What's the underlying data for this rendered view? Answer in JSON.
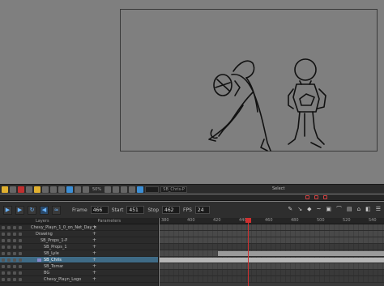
{
  "toolbar": {
    "zoom": "50%",
    "layer_name": "SB_Chris-P",
    "mode_label": "Select"
  },
  "playback": {
    "frame_label": "Frame",
    "frame_value": "466",
    "start_label": "Start",
    "start_value": "451",
    "stop_label": "Stop",
    "stop_value": "462",
    "fps_label": "FPS",
    "fps_value": "24"
  },
  "layers_panel": {
    "header_layers": "Layers",
    "header_parameters": "Parameters",
    "rows": [
      {
        "name": "Chevy_Playn_1_0_on_Net_Day_e",
        "selected": false
      },
      {
        "name": "Drawing",
        "selected": false
      },
      {
        "name": "SB_Props_1-P",
        "selected": false
      },
      {
        "name": "SB_Props_1",
        "selected": false
      },
      {
        "name": "SB_Lyle",
        "selected": false
      },
      {
        "name": "SB_Chris",
        "selected": true
      },
      {
        "name": "SB_Tomar",
        "selected": false
      },
      {
        "name": "BG",
        "selected": false
      },
      {
        "name": "Chevy_Playn_Logo",
        "selected": false
      }
    ]
  },
  "timeline": {
    "ruler_labels": [
      "380",
      "400",
      "420",
      "440",
      "460",
      "480",
      "500",
      "520",
      "540"
    ]
  },
  "colors": {
    "selection_blue": "#3f6b86",
    "playhead_red": "#d03030",
    "accent_blue": "#3c8fd6"
  }
}
